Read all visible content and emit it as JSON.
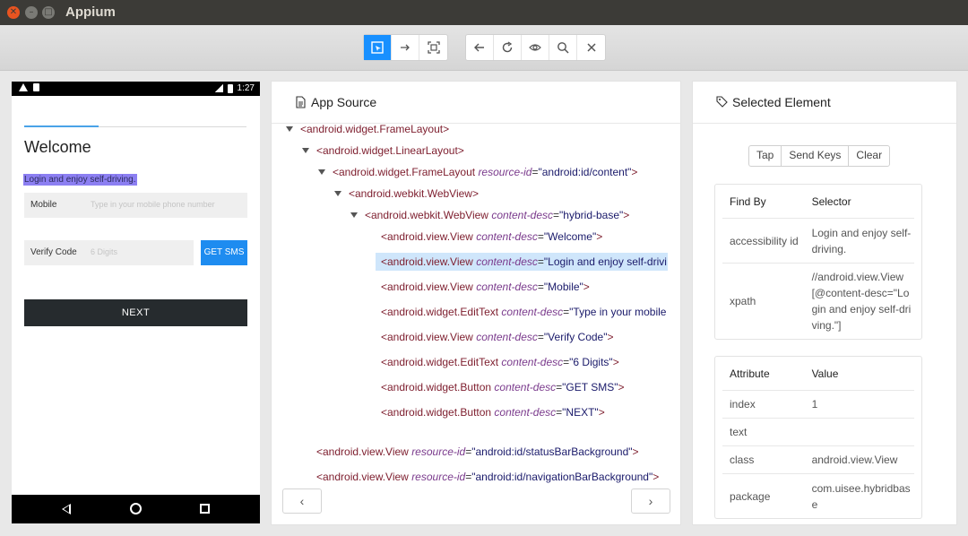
{
  "window": {
    "title": "Appium"
  },
  "toolbar": {
    "group1": [
      "select-element-icon",
      "swipe-icon",
      "tap-coordinates-icon"
    ],
    "group2": [
      "back-icon",
      "refresh-icon",
      "eye-icon",
      "search-icon",
      "close-icon"
    ]
  },
  "device": {
    "time": "1:27",
    "welcome": "Welcome",
    "subtitle": "Login and enjoy self-driving.",
    "mobile_label": "Mobile",
    "mobile_placeholder": "Type in your mobile phone number",
    "code_label": "Verify Code",
    "code_placeholder": "6 Digits",
    "get_sms": "GET SMS",
    "next": "NEXT"
  },
  "source": {
    "title": "App Source",
    "nodes": [
      {
        "tag": "<android.widget.FrameLayout>",
        "attr": "",
        "val": "",
        "end": ""
      },
      {
        "tag": "<android.widget.LinearLayout>",
        "attr": "",
        "val": "",
        "end": ""
      },
      {
        "tag": "<android.widget.FrameLayout ",
        "attr": "resource-id",
        "val": "\"android:id/content\"",
        "end": ">"
      },
      {
        "tag": "<android.webkit.WebView>",
        "attr": "",
        "val": "",
        "end": ""
      },
      {
        "tag": "<android.webkit.WebView ",
        "attr": "content-desc",
        "val": "\"hybrid-base\"",
        "end": ">"
      },
      {
        "tag": "<android.view.View ",
        "attr": "content-desc",
        "val": "\"Welcome\"",
        "end": ">"
      },
      {
        "tag": "<android.view.View ",
        "attr": "content-desc",
        "val": "\"Login and enjoy self-drivi",
        "end": ""
      },
      {
        "tag": "<android.view.View ",
        "attr": "content-desc",
        "val": "\"Mobile\"",
        "end": ">"
      },
      {
        "tag": "<android.widget.EditText ",
        "attr": "content-desc",
        "val": "\"Type in your mobile",
        "end": ""
      },
      {
        "tag": "<android.view.View ",
        "attr": "content-desc",
        "val": "\"Verify Code\"",
        "end": ">"
      },
      {
        "tag": "<android.widget.EditText ",
        "attr": "content-desc",
        "val": "\"6 Digits\"",
        "end": ">"
      },
      {
        "tag": "<android.widget.Button ",
        "attr": "content-desc",
        "val": "\"GET SMS\"",
        "end": ">"
      },
      {
        "tag": "<android.widget.Button ",
        "attr": "content-desc",
        "val": "\"NEXT\"",
        "end": ">"
      },
      {
        "tag": "<android.view.View ",
        "attr": "resource-id",
        "val": "\"android:id/statusBarBackground\"",
        "end": ">"
      },
      {
        "tag": "<android.view.View ",
        "attr": "resource-id",
        "val": "\"android:id/navigationBarBackground\"",
        "end": ">"
      }
    ],
    "prev": "‹",
    "next": "›"
  },
  "selected": {
    "title": "Selected Element",
    "actions": [
      "Tap",
      "Send Keys",
      "Clear"
    ],
    "findby_header": [
      "Find By",
      "Selector"
    ],
    "findby_rows": [
      [
        "accessibility id",
        "Login and enjoy self-driving."
      ],
      [
        "xpath",
        "//android.view.View[@content-desc=\"Login and enjoy self-driving.\"]"
      ]
    ],
    "attr_header": [
      "Attribute",
      "Value"
    ],
    "attr_rows": [
      [
        "index",
        "1"
      ],
      [
        "text",
        ""
      ],
      [
        "class",
        "android.view.View"
      ],
      [
        "package",
        "com.uisee.hybridbase"
      ]
    ]
  }
}
